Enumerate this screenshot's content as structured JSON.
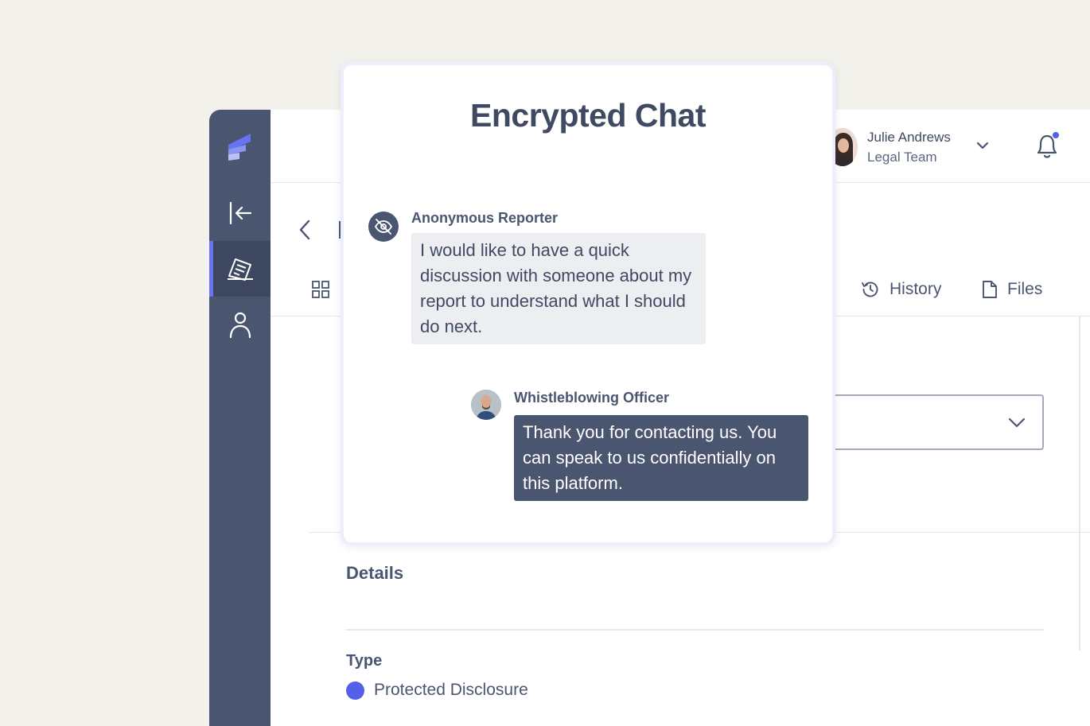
{
  "header": {
    "user_name": "Julie Andrews",
    "user_team": "Legal Team"
  },
  "tabs": [
    {
      "label": "History",
      "icon": "history-icon"
    },
    {
      "label": "Files",
      "icon": "file-icon"
    }
  ],
  "details": {
    "title": "Details",
    "type_label": "Type",
    "type_value": "Protected Disclosure",
    "type_color": "#5460e8"
  },
  "chat": {
    "title": "Encrypted Chat",
    "messages": [
      {
        "sender": "Anonymous Reporter",
        "text": "I would like to have a quick discussion with someone about my report to understand what I should do next."
      },
      {
        "sender": "Whistleblowing Officer",
        "text": "Thank you for contacting us. You can speak to us confidentially on this platform."
      }
    ]
  },
  "colors": {
    "sidebar": "#4a5570",
    "accent": "#5460e8",
    "background": "#f2f1ec"
  }
}
